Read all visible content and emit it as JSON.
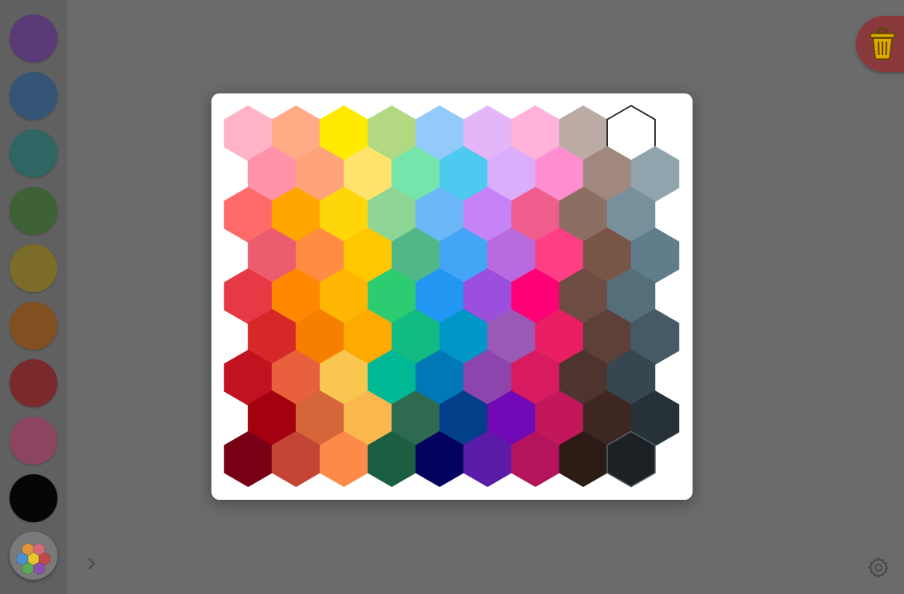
{
  "sidebar": {
    "swatches": [
      {
        "name": "purple",
        "color": "#5a3a76"
      },
      {
        "name": "blue",
        "color": "#345575"
      },
      {
        "name": "teal",
        "color": "#2f6563"
      },
      {
        "name": "green",
        "color": "#3e6235"
      },
      {
        "name": "olive",
        "color": "#7c6c2a"
      },
      {
        "name": "orange",
        "color": "#824f20"
      },
      {
        "name": "red",
        "color": "#7a2a2a"
      },
      {
        "name": "pink",
        "color": "#8c4560"
      },
      {
        "name": "black",
        "color": "#050505"
      }
    ],
    "palette_button_icon": "hexagon-palette-icon",
    "expand_icon": "chevron-right-icon"
  },
  "toolbar": {
    "trash_icon": "trash-icon",
    "trash_button_color": "#8a3a3a",
    "settings_icon": "gear-icon"
  },
  "color_picker": {
    "rows": [
      [
        "#ffb3c6",
        "#ffab85",
        "#ffea00",
        "#b2d882",
        "#92caf9",
        "#e4b6f8",
        "#ffb2da",
        "#bcaaa4",
        "#ffffff"
      ],
      [
        "#ff92a8",
        "#ffa37a",
        "#ffe36c",
        "#75e5ab",
        "#4ccaf0",
        "#dbaefc",
        "#ff8ed0",
        "#a1887f",
        "#90a4ae"
      ],
      [
        "#ff6b6b",
        "#ffa500",
        "#ffd60a",
        "#8fd696",
        "#6cb7f5",
        "#c683f8",
        "#ef5d8d",
        "#8d6e63",
        "#78909c"
      ],
      [
        "#eb5d6e",
        "#ff8c40",
        "#ffc700",
        "#52b788",
        "#42a5f5",
        "#b86bde",
        "#ff3e83",
        "#795548",
        "#607d8b"
      ],
      [
        "#e63946",
        "#ff8800",
        "#ffb703",
        "#2ecc71",
        "#2196f3",
        "#9b4fdd",
        "#ff0077",
        "#6d4c41",
        "#546e7a"
      ],
      [
        "#d62828",
        "#f77f00",
        "#ffaa00",
        "#12bb82",
        "#0096c7",
        "#9b59b6",
        "#e91e63",
        "#5d4037",
        "#455a64"
      ],
      [
        "#c1121f",
        "#e8613c",
        "#f9c74f",
        "#00b894",
        "#0077b6",
        "#8e44ad",
        "#d81b60",
        "#4e342e",
        "#37474f"
      ],
      [
        "#a4000f",
        "#d4663a",
        "#f9b74d",
        "#2d6a4f",
        "#023e8a",
        "#7209b7",
        "#c2185b",
        "#3e2723",
        "#263238"
      ],
      [
        "#780014",
        "#c44536",
        "#fe8a4a",
        "#1b5e42",
        "#03035f",
        "#5c1ba6",
        "#b5145c",
        "#2d1b16",
        "#1c2126"
      ]
    ]
  }
}
